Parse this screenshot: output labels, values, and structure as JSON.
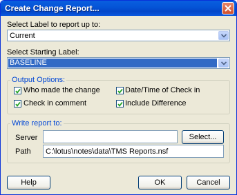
{
  "dialog": {
    "title": "Create Change Report..."
  },
  "report_up_to": {
    "label": "Select Label to report up to:",
    "value": "Current"
  },
  "starting_label": {
    "label": "Select Starting Label:",
    "value": "BASELINE"
  },
  "output_options": {
    "legend": "Output Options:",
    "who_made_change": {
      "label": "Who made the change",
      "checked": true
    },
    "date_time_check_in": {
      "label": "Date/Time of Check in",
      "checked": true
    },
    "check_in_comment": {
      "label": "Check in comment",
      "checked": true
    },
    "include_difference": {
      "label": "Include Difference",
      "checked": true
    }
  },
  "write_report": {
    "legend": "Write report to:",
    "server_label": "Server",
    "server_value": "",
    "select_button": "Select...",
    "path_label": "Path",
    "path_value": "C:\\lotus\\notes\\data\\TMS Reports.nsf"
  },
  "buttons": {
    "help": "Help",
    "ok": "OK",
    "cancel": "Cancel"
  }
}
